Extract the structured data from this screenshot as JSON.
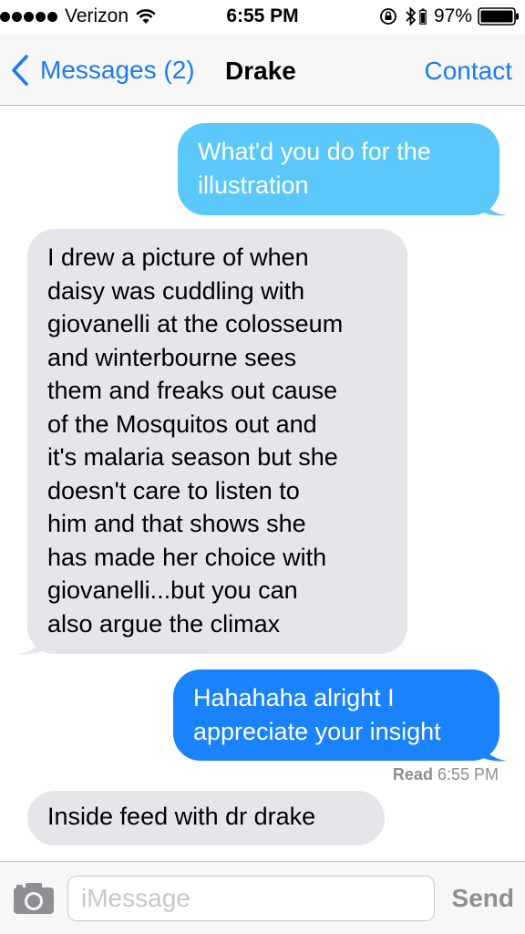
{
  "status_bar": {
    "carrier": "Verizon",
    "time": "6:55 PM",
    "battery_percent": "97%"
  },
  "nav": {
    "back_label": "Messages (2)",
    "title": "Drake",
    "contact_label": "Contact"
  },
  "messages": [
    {
      "direction": "outgoing",
      "type": "sms",
      "text": "What'd you do for the\nillustration"
    },
    {
      "direction": "incoming",
      "text": "I drew a picture of when\ndaisy was cuddling with\ngiovanelli at the colosseum\nand winterbourne sees\nthem and freaks out cause\nof the Mosquitos out and\nit's malaria season but she\ndoesn't care to listen to\nhim and that shows she\nhas made her choice with\ngiovanelli...but you can\nalso argue the climax"
    },
    {
      "direction": "outgoing",
      "type": "imessage",
      "text": "Hahahaha alright I\nappreciate your insight"
    },
    {
      "direction": "incoming",
      "text": "Inside feed with dr drake"
    }
  ],
  "read_receipt": {
    "label": "Read",
    "time": "6:55 PM"
  },
  "input": {
    "placeholder": "iMessage",
    "value": "",
    "send_label": "Send"
  },
  "colors": {
    "accent": "#1a7cf5",
    "sms_bubble": "#5ac8fa",
    "imessage_bubble": "#1a82fb",
    "incoming_bubble": "#e5e5ea"
  },
  "icons": [
    "wifi-icon",
    "rotation-lock-icon",
    "bluetooth-icon",
    "battery-icon",
    "chevron-left-icon",
    "camera-icon"
  ]
}
